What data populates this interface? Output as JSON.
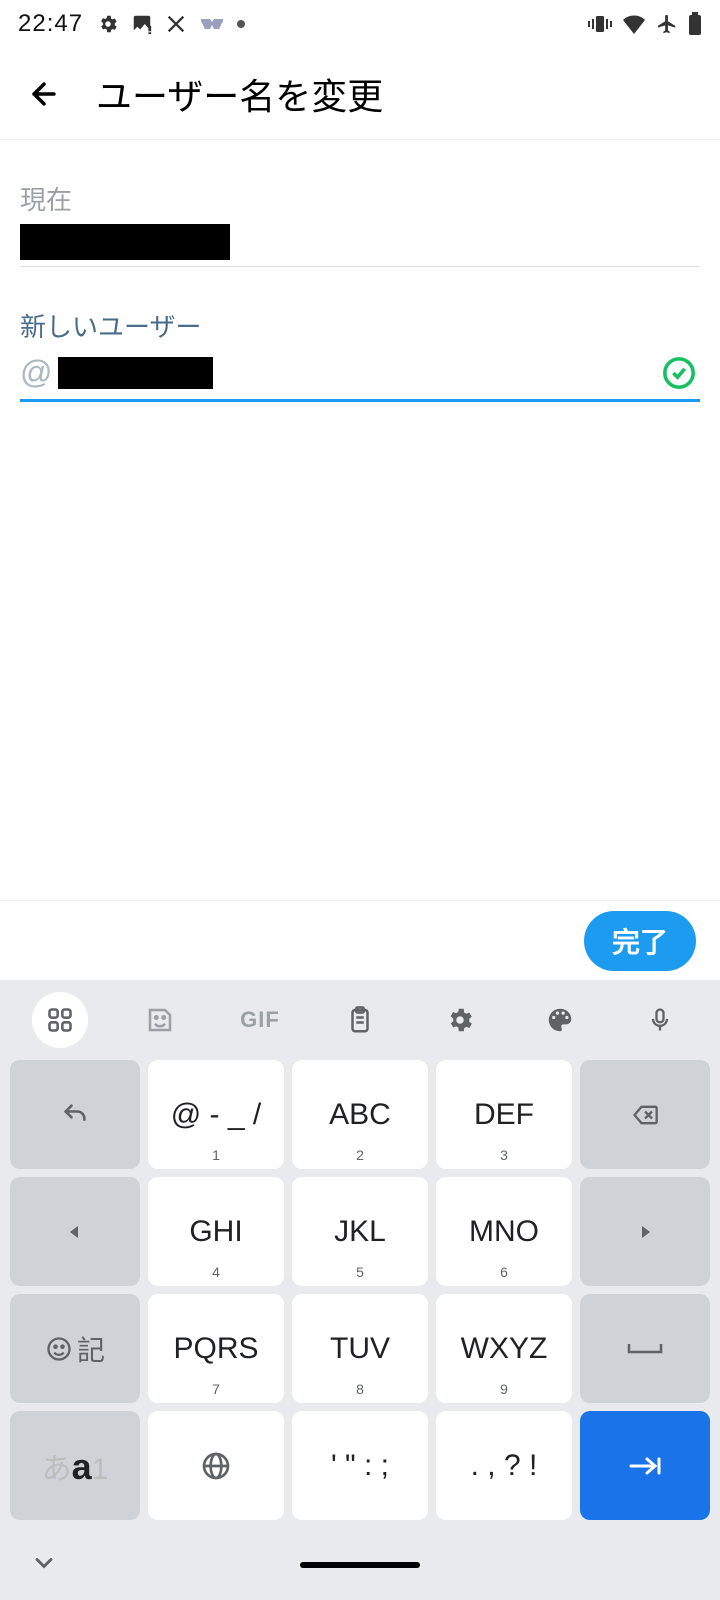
{
  "statusbar": {
    "time": "22:47"
  },
  "appbar": {
    "title": "ユーザー名を変更"
  },
  "form": {
    "current_label": "現在",
    "new_label": "新しいユーザー",
    "at": "@"
  },
  "done_bar": {
    "label": "完了"
  },
  "keyboard": {
    "toolbar_gif": "GIF",
    "keys": {
      "r1c2_main": "@ - _ /",
      "r1c2_sub": "1",
      "r1c3_main": "ABC",
      "r1c3_sub": "2",
      "r1c4_main": "DEF",
      "r1c4_sub": "3",
      "r2c2_main": "GHI",
      "r2c2_sub": "4",
      "r2c3_main": "JKL",
      "r2c3_sub": "5",
      "r2c4_main": "MNO",
      "r2c4_sub": "6",
      "r3c2_main": "PQRS",
      "r3c2_sub": "7",
      "r3c3_main": "TUV",
      "r3c3_sub": "8",
      "r3c4_main": "WXYZ",
      "r3c4_sub": "9",
      "r4c3_main": "' \" : ;",
      "r4c4_main": ". , ? !",
      "mode_a": "あ",
      "mode_A": "a",
      "mode_1": "1",
      "emoji_label": "記"
    }
  }
}
